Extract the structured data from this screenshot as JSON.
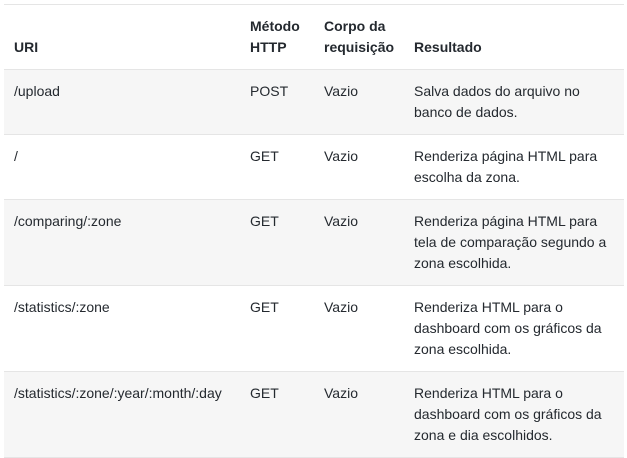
{
  "table": {
    "headers": {
      "uri": "URI",
      "method": "Método HTTP",
      "body": "Corpo da requisição",
      "result": "Resultado"
    },
    "rows": [
      {
        "uri": "/upload",
        "method": "POST",
        "body": "Vazio",
        "result": "Salva dados do arquivo no banco de dados."
      },
      {
        "uri": "/",
        "method": "GET",
        "body": "Vazio",
        "result": "Renderiza página HTML para escolha da zona."
      },
      {
        "uri": "/comparing/:zone",
        "method": "GET",
        "body": "Vazio",
        "result": "Renderiza página HTML para tela de comparação segundo a zona escolhida."
      },
      {
        "uri": "/statistics/:zone",
        "method": "GET",
        "body": "Vazio",
        "result": "Renderiza HTML para o dashboard com os gráficos da zona escolhida."
      },
      {
        "uri": "/statistics/:zone/:year/:month/:day",
        "method": "GET",
        "body": "Vazio",
        "result": "Renderiza HTML para o dashboard com os gráficos da zona e dia escolhidos."
      }
    ]
  }
}
